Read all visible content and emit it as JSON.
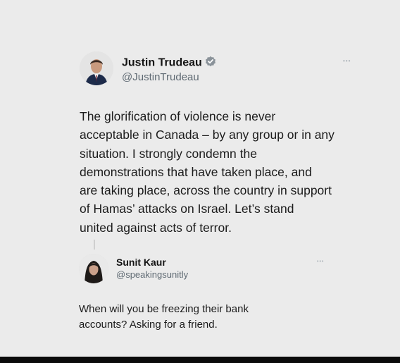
{
  "main_tweet": {
    "author_name": "Justin Trudeau",
    "handle": "@JustinTrudeau",
    "verified": true,
    "more_label": "•••",
    "text": "The glorification of violence is never\nacceptable in Canada – by any group or in any\nsituation. I strongly condemn the\ndemonstrations that have taken place, and\nare taking place, across the country in support\nof Hamas’ attacks on Israel. Let’s stand\nunited against acts of terror."
  },
  "reply_tweet": {
    "author_name": "Sunit Kaur",
    "handle": "@speakingsunitly",
    "more_label": "•••",
    "text": "When will you be freezing their bank\naccounts? Asking for a friend."
  },
  "colors": {
    "background": "#ebebeb",
    "verified_badge": "#8a9299",
    "handle_text": "#5f6a73"
  },
  "icons": {
    "verified": "verified-badge-icon",
    "more": "more-options-icon"
  }
}
